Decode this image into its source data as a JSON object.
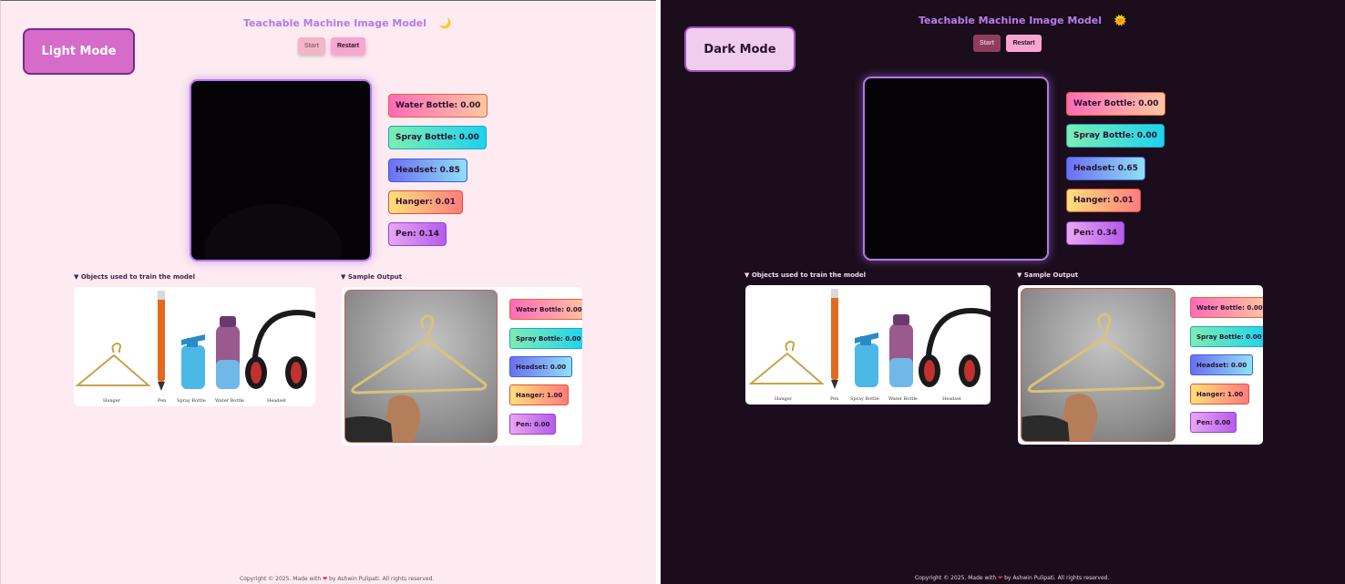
{
  "app_title": "Teachable Machine Image Model",
  "buttons": {
    "start": "Start",
    "restart": "Restart"
  },
  "sections": {
    "objects": "▼  Objects used to train the model",
    "sample": "▼  Sample Output"
  },
  "object_captions": [
    "Hanger",
    "Pen",
    "Spray Bottle",
    "Water Bottle",
    "Headset"
  ],
  "footer": {
    "prefix": "Copyright © 2025. Made with ",
    "heart": "❤",
    "suffix": " by Ashwin Pulipati. All rights reserved."
  },
  "light": {
    "mode_label": "Light Mode",
    "theme_icon": "moon-icon",
    "theme_glyph": "🌙",
    "predictions": [
      {
        "label": "Water Bottle: 0.00",
        "value": 0.0
      },
      {
        "label": "Spray Bottle: 0.00",
        "value": 0.0
      },
      {
        "label": "Headset: 0.85",
        "value": 0.85
      },
      {
        "label": "Hanger: 0.01",
        "value": 0.01
      },
      {
        "label": "Pen: 0.14",
        "value": 0.14
      }
    ]
  },
  "dark": {
    "mode_label": "Dark Mode",
    "theme_icon": "sun-icon",
    "theme_glyph": "🌞",
    "predictions": [
      {
        "label": "Water Bottle: 0.00",
        "value": 0.0
      },
      {
        "label": "Spray Bottle: 0.00",
        "value": 0.0
      },
      {
        "label": "Headset: 0.65",
        "value": 0.65
      },
      {
        "label": "Hanger: 0.01",
        "value": 0.01
      },
      {
        "label": "Pen: 0.34",
        "value": 0.34
      }
    ]
  },
  "sample_predictions": [
    {
      "label": "Water Bottle: 0.00",
      "value": 0.0
    },
    {
      "label": "Spray Bottle: 0.00",
      "value": 0.0
    },
    {
      "label": "Headset: 0.00",
      "value": 0.0
    },
    {
      "label": "Hanger: 1.00",
      "value": 1.0
    },
    {
      "label": "Pen: 0.00",
      "value": 0.0
    }
  ],
  "colors": {
    "light_bg": "#fdebf1",
    "dark_bg": "#1b0d1c",
    "title_purple": "#b17be8",
    "webcam_border": "#b07ae6"
  }
}
